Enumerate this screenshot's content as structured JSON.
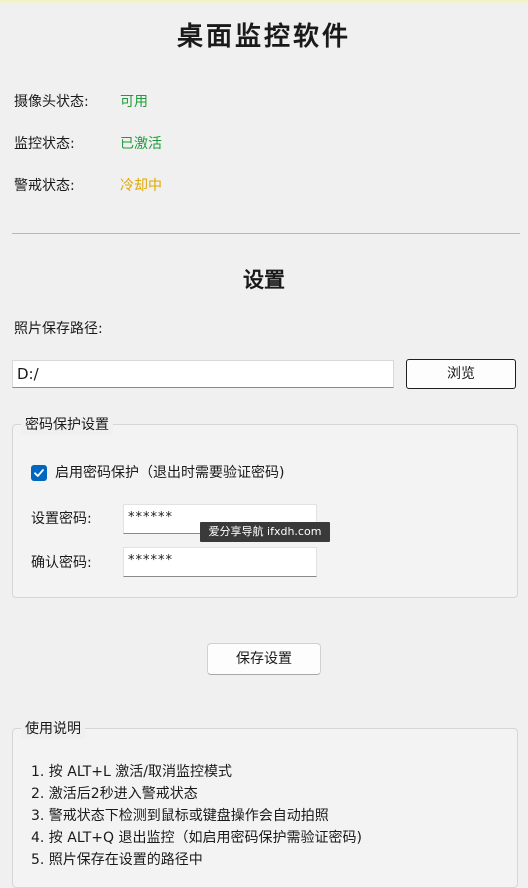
{
  "app": {
    "title": "桌面监控软件"
  },
  "status": [
    {
      "label": "摄像头状态:",
      "value": "可用",
      "color": "#1e9c3a"
    },
    {
      "label": "监控状态:",
      "value": "已激活",
      "color": "#1e9c3a"
    },
    {
      "label": "警戒状态:",
      "value": "冷却中",
      "color": "#e0a800"
    }
  ],
  "settings": {
    "title": "设置",
    "photo_path_label": "照片保存路径:",
    "photo_path_value": "D:/",
    "browse_label": "浏览",
    "password_group": {
      "legend": "密码保护设置",
      "enable_checkbox_label": "启用密码保护（退出时需要验证密码)",
      "enable_checked": true,
      "set_password_label": "设置密码:",
      "set_password_value": "******",
      "confirm_password_label": "确认密码:",
      "confirm_password_value": "******"
    },
    "save_label": "保存设置"
  },
  "usage": {
    "legend": "使用说明",
    "items": [
      "1. 按 ALT+L 激活/取消监控模式",
      "2. 激活后2秒进入警戒状态",
      "3. 警戒状态下检测到鼠标或键盘操作会自动拍照",
      "4. 按 ALT+Q 退出监控（如启用密码保护需验证密码)",
      "5. 照片保存在设置的路径中"
    ]
  },
  "watermark": {
    "text": "爱分享导航 ifxdh.com"
  }
}
